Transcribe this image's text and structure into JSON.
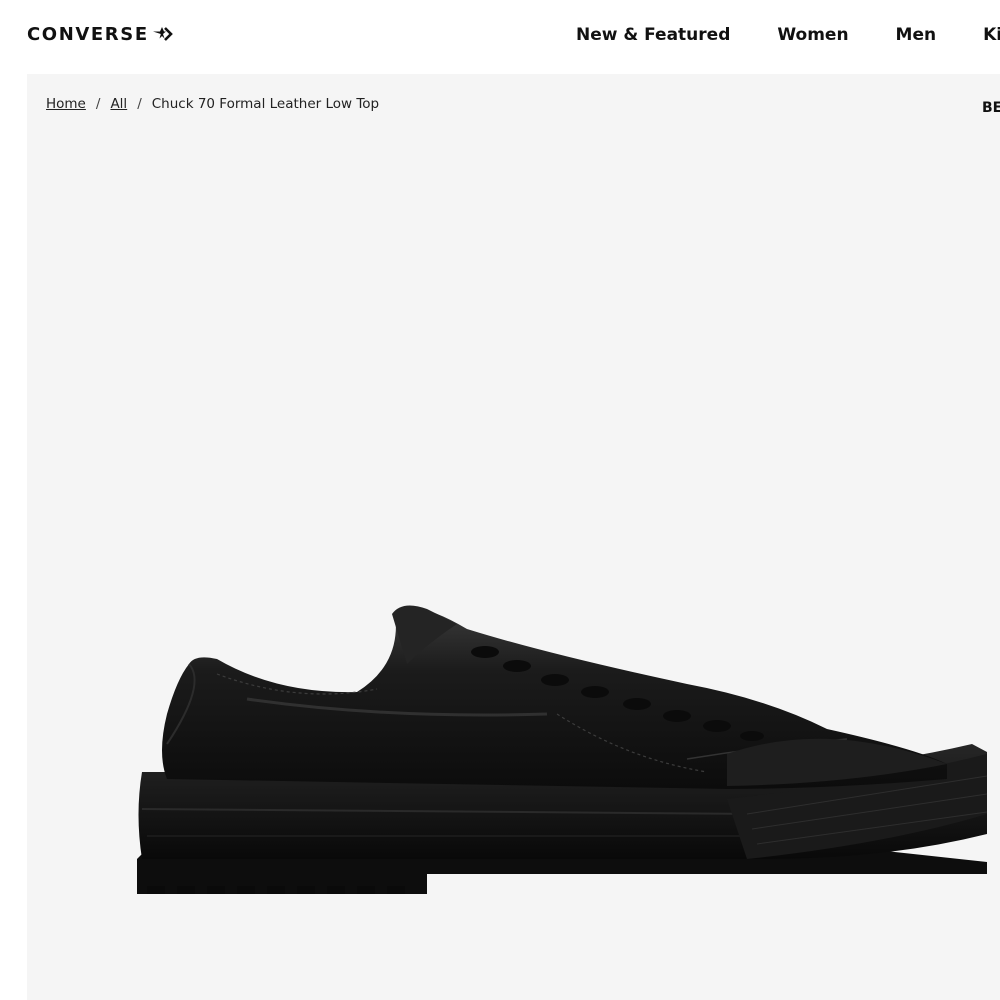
{
  "header": {
    "logo_text": "CONVERSE",
    "logo_icon": "converse-chevron-star-icon",
    "nav": [
      {
        "label": "New & Featured"
      },
      {
        "label": "Women"
      },
      {
        "label": "Men"
      },
      {
        "label": "Kids"
      }
    ]
  },
  "breadcrumb": {
    "items": [
      {
        "label": "Home"
      },
      {
        "label": "All"
      }
    ],
    "separator": "/",
    "current": "Chuck 70 Formal Leather Low Top"
  },
  "badge": {
    "label_partial": "BE"
  },
  "product": {
    "image_alt": "Chuck 70 Formal Leather Low Top black shoe",
    "colors": {
      "leather": "#151515",
      "sole": "#0e0e0e",
      "background": "#f5f5f5"
    }
  }
}
